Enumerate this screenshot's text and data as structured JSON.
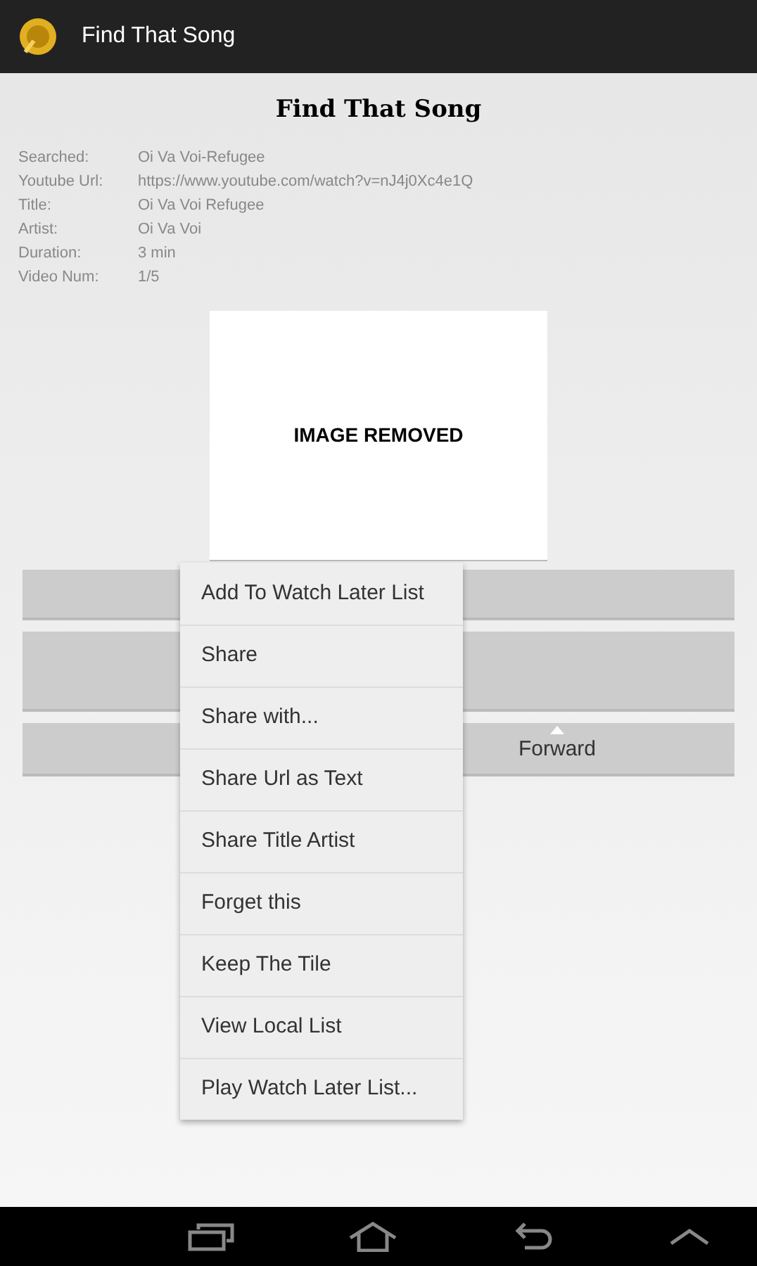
{
  "action_bar": {
    "title": "Find That Song"
  },
  "heading": "Find That Song",
  "details": [
    {
      "label": "Searched:",
      "value": "Oi Va Voi-Refugee"
    },
    {
      "label": "Youtube Url:",
      "value": "https://www.youtube.com/watch?v=nJ4j0Xc4e1Q"
    },
    {
      "label": "Title:",
      "value": "Oi Va Voi Refugee"
    },
    {
      "label": "Artist:",
      "value": "Oi Va Voi"
    },
    {
      "label": "Duration:",
      "value": "3 min"
    },
    {
      "label": "Video Num:",
      "value": "1/5"
    }
  ],
  "image_placeholder": "IMAGE REMOVED",
  "buttons": {
    "forward": "Forward"
  },
  "menu": [
    "Add To Watch Later List",
    "Share",
    "Share with...",
    "Share Url as Text",
    "Share Title Artist",
    "Forget this",
    "Keep The Tile",
    "View Local List",
    "Play Watch Later List..."
  ]
}
